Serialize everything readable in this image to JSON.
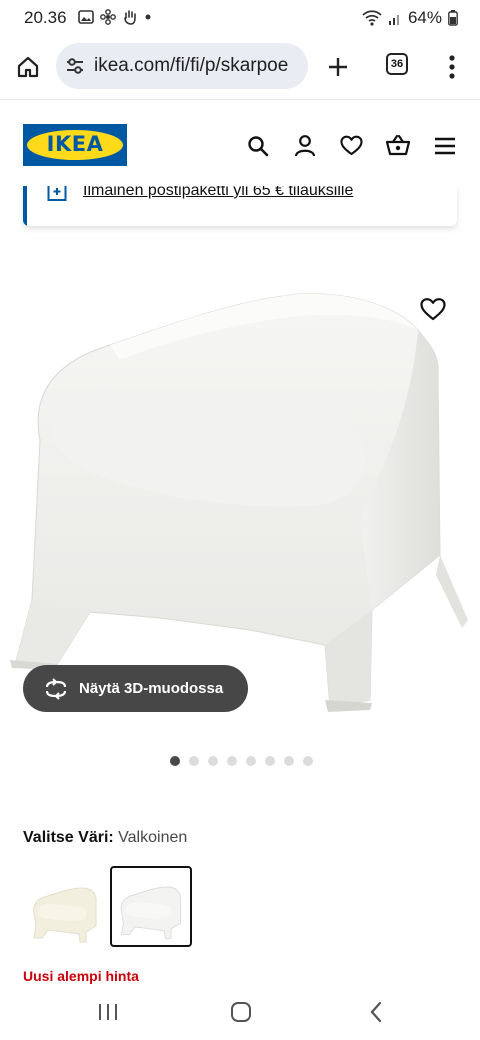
{
  "status_bar": {
    "time": "20.36",
    "battery": "64%"
  },
  "browser": {
    "url": "ikea.com/fi/fi/p/skarpoe",
    "tab_count": "36"
  },
  "header": {
    "logo_text": "IKEA",
    "icons": [
      "search-icon",
      "account-icon",
      "heart-icon",
      "basket-icon",
      "menu-icon"
    ]
  },
  "promo": {
    "text": "Ilmainen postipaketti yli 65 € tilauksille"
  },
  "product": {
    "view_3d_label": "Näytä 3D-muodossa",
    "carousel": {
      "count": 8,
      "active": 1
    },
    "color_label": "Valitse Väri:",
    "color_value": "Valkoinen",
    "price_tag": "Uusi alempi hinta"
  },
  "colors": {
    "ikea_blue": "#0058a3",
    "ikea_yellow": "#ffda1a",
    "pill_bg": "#474747",
    "price_red": "#cc0008"
  }
}
